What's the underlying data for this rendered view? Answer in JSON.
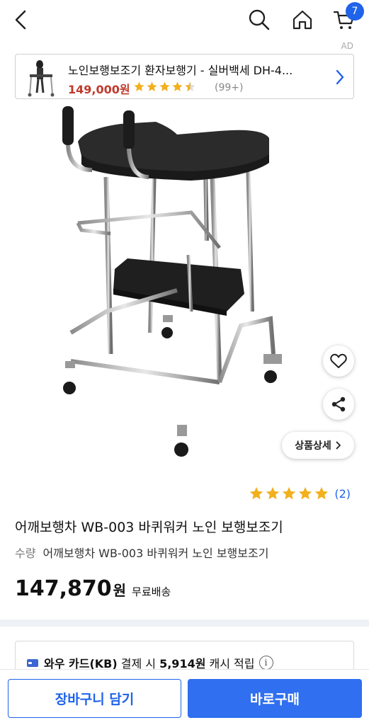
{
  "header": {
    "cart_count": "7",
    "accent_color": "#1e63e9"
  },
  "ad": {
    "label": "AD",
    "title": "노인보행보조기 환자보행기 - 실버백세 DH-4...",
    "price": "149,000원",
    "rating": 4.5,
    "reviews": "(99+)"
  },
  "product": {
    "rating": 5,
    "review_count": "(2)",
    "title": "어깨보행차 WB-003 바퀴워커 노인 보행보조기",
    "option_label": "수량",
    "option_value": "어깨보행차 WB-003 바퀴워커 노인 보행보조기",
    "price": "147,870",
    "price_unit": "원",
    "shipping": "무료배송",
    "detail_button": "상품상세"
  },
  "promo": {
    "brand": "와우 카드(KB)",
    "mid": " 결제 시 ",
    "amount": "5,914원",
    "suffix": " 캐시 적립",
    "info": "i"
  },
  "actions": {
    "add_to_cart": "장바구니 담기",
    "buy_now": "바로구매"
  }
}
